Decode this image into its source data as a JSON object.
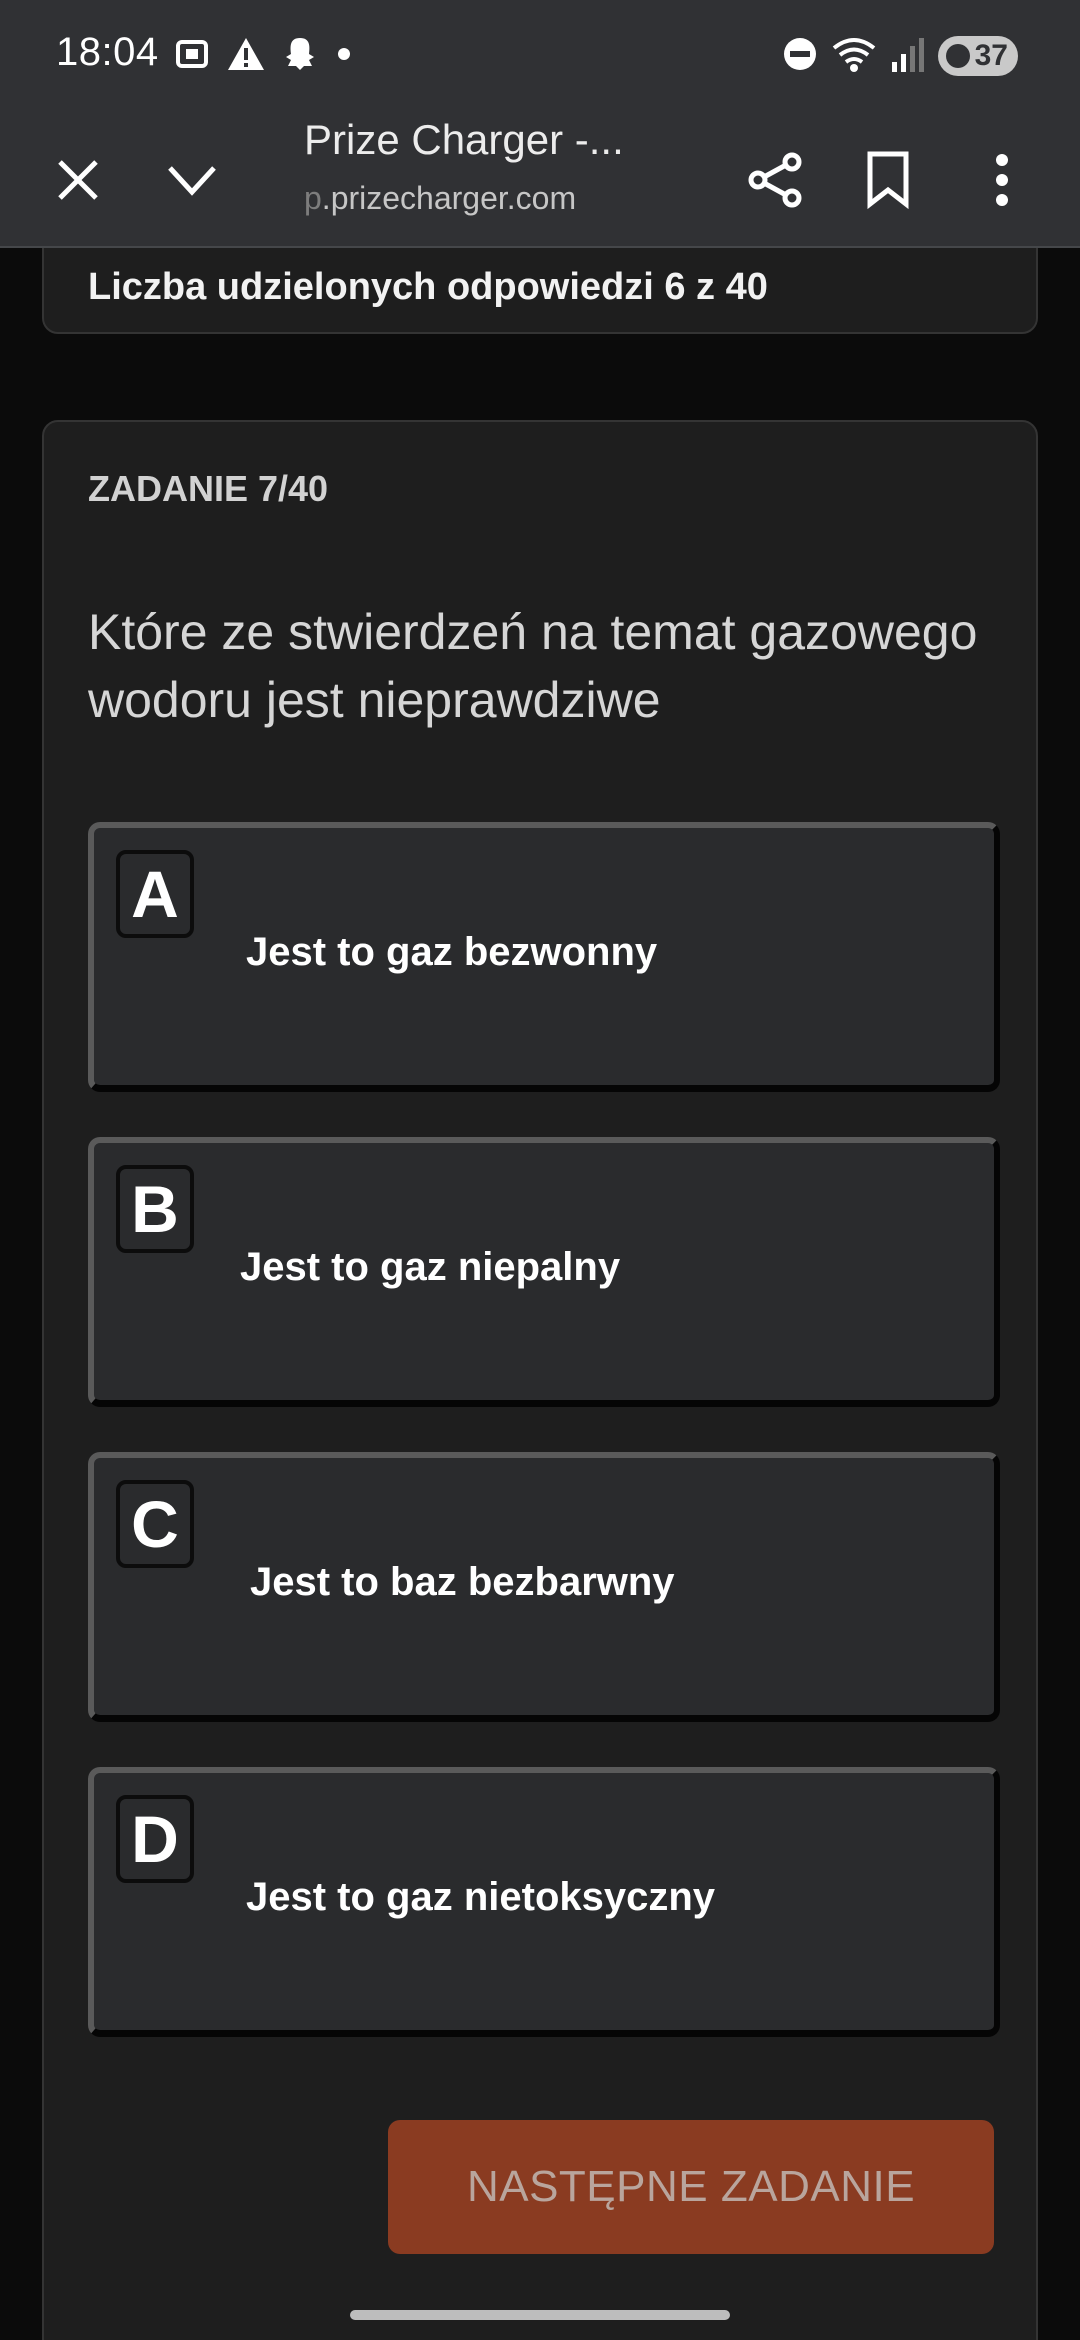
{
  "status_bar": {
    "time": "18:04",
    "left_icons": [
      "screenshot-icon",
      "warning-icon",
      "snapchat-icon",
      "dot-icon"
    ],
    "right_icons": [
      "dnd-icon",
      "wifi-icon",
      "signal-icon"
    ],
    "battery": "37"
  },
  "browser": {
    "title": "Prize Charger -...",
    "url_prefix": "p",
    "url_rest": ".prizecharger.com"
  },
  "progress": {
    "text": "Liczba udzielonych odpowiedzi 6 z 40"
  },
  "task": {
    "label": "ZADANIE 7/40",
    "question": "Które ze stwierdzeń na temat gazowego wodoru jest nieprawdziwe",
    "answers": [
      {
        "letter": "A",
        "text": "Jest to gaz bezwonny"
      },
      {
        "letter": "B",
        "text": "Jest to gaz niepalny"
      },
      {
        "letter": "C",
        "text": "Jest to baz bezbarwny"
      },
      {
        "letter": "D",
        "text": "Jest to gaz nietoksyczny"
      }
    ],
    "next_button": "NASTĘPNE ZADANIE"
  },
  "colors": {
    "chrome": "#303134",
    "card": "#1e1e1e",
    "answer": "#2a2b2d",
    "next_button": "#8a3b21"
  }
}
